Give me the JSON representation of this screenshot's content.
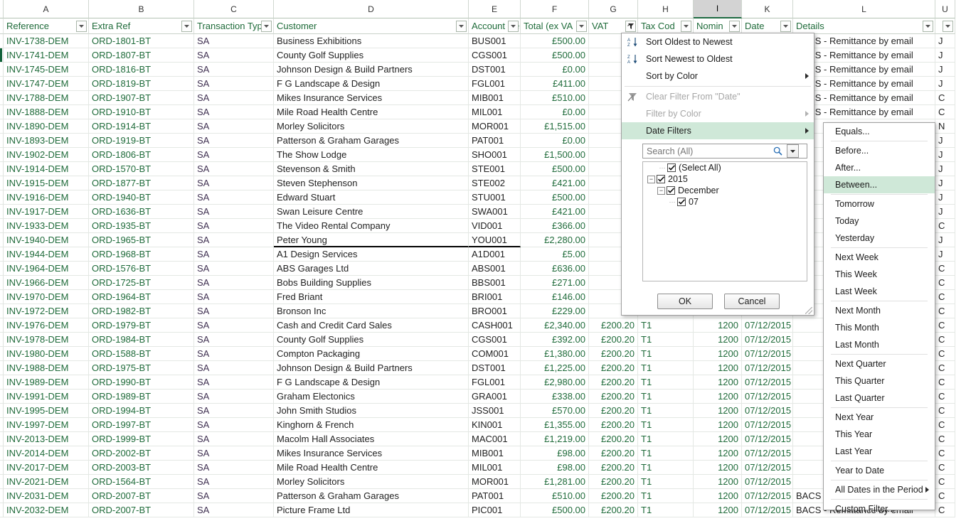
{
  "spreadsheet": {
    "column_letters": [
      "A",
      "B",
      "C",
      "D",
      "E",
      "F",
      "G",
      "H",
      "I",
      "K",
      "L",
      "U"
    ],
    "selected_column": "I",
    "headers": [
      {
        "label": "Reference",
        "filtered": false
      },
      {
        "label": "Extra Ref",
        "filtered": false
      },
      {
        "label": "Transaction Typ",
        "filtered": false
      },
      {
        "label": "Customer",
        "filtered": false
      },
      {
        "label": "Account Re",
        "filtered": false
      },
      {
        "label": "Total (ex VA",
        "filtered": false
      },
      {
        "label": "VAT",
        "filtered": true
      },
      {
        "label": "Tax Cod",
        "filtered": false
      },
      {
        "label": "Nomin",
        "filtered": false
      },
      {
        "label": "Date",
        "filtered": false
      },
      {
        "label": "Details",
        "filtered": false
      },
      {
        "label": "",
        "filtered": false
      }
    ],
    "rows": [
      {
        "reference": "INV-1738-DEM",
        "extra_ref": "ORD-1801-BT",
        "transaction_type": "SA",
        "customer": "Business Exhibitions",
        "account_ref": "BUS001",
        "total_ex_vat": "£500.00",
        "vat": "",
        "tax_code": "",
        "nominal": "",
        "date": "",
        "details": "BACS - Remittance by email",
        "last": "J"
      },
      {
        "reference": "INV-1741-DEM",
        "extra_ref": "ORD-1807-BT",
        "transaction_type": "SA",
        "customer": "County Golf Supplies",
        "account_ref": "CGS001",
        "total_ex_vat": "£500.00",
        "vat": "",
        "tax_code": "",
        "nominal": "",
        "date": "",
        "details": "BACS - Remittance by email",
        "last": "J"
      },
      {
        "reference": "INV-1745-DEM",
        "extra_ref": "ORD-1816-BT",
        "transaction_type": "SA",
        "customer": "Johnson Design & Build Partners",
        "account_ref": "DST001",
        "total_ex_vat": "£0.00",
        "vat": "",
        "tax_code": "",
        "nominal": "",
        "date": "",
        "details": "BACS - Remittance by email",
        "last": "J"
      },
      {
        "reference": "INV-1747-DEM",
        "extra_ref": "ORD-1819-BT",
        "transaction_type": "SA",
        "customer": "F G Landscape & Design",
        "account_ref": "FGL001",
        "total_ex_vat": "£411.00",
        "vat": "",
        "tax_code": "",
        "nominal": "",
        "date": "",
        "details": "BACS - Remittance by email",
        "last": "J"
      },
      {
        "reference": "INV-1788-DEM",
        "extra_ref": "ORD-1907-BT",
        "transaction_type": "SA",
        "customer": "Mikes Insurance Services",
        "account_ref": "MIB001",
        "total_ex_vat": "£510.00",
        "vat": "",
        "tax_code": "",
        "nominal": "",
        "date": "",
        "details": "BACS - Remittance by email",
        "last": "C"
      },
      {
        "reference": "INV-1888-DEM",
        "extra_ref": "ORD-1910-BT",
        "transaction_type": "SA",
        "customer": "Mile Road Health Centre",
        "account_ref": "MIL001",
        "total_ex_vat": "£0.00",
        "vat": "",
        "tax_code": "",
        "nominal": "",
        "date": "",
        "details": "BACS - Remittance by email",
        "last": "C"
      },
      {
        "reference": "INV-1890-DEM",
        "extra_ref": "ORD-1914-BT",
        "transaction_type": "SA",
        "customer": "Morley Solicitors",
        "account_ref": "MOR001",
        "total_ex_vat": "£1,515.00",
        "vat": "",
        "tax_code": "",
        "nominal": "",
        "date": "",
        "details": "",
        "last": "N"
      },
      {
        "reference": "INV-1893-DEM",
        "extra_ref": "ORD-1919-BT",
        "transaction_type": "SA",
        "customer": "Patterson & Graham Garages",
        "account_ref": "PAT001",
        "total_ex_vat": "£0.00",
        "vat": "",
        "tax_code": "",
        "nominal": "",
        "date": "",
        "details": "",
        "last": "J"
      },
      {
        "reference": "INV-1902-DEM",
        "extra_ref": "ORD-1806-BT",
        "transaction_type": "SA",
        "customer": "The Show Lodge",
        "account_ref": "SHO001",
        "total_ex_vat": "£1,500.00",
        "vat": "",
        "tax_code": "",
        "nominal": "",
        "date": "",
        "details": "",
        "last": "J"
      },
      {
        "reference": "INV-1914-DEM",
        "extra_ref": "ORD-1570-BT",
        "transaction_type": "SA",
        "customer": "Stevenson & Smith",
        "account_ref": "STE001",
        "total_ex_vat": "£500.00",
        "vat": "",
        "tax_code": "",
        "nominal": "",
        "date": "",
        "details": "",
        "last": "J"
      },
      {
        "reference": "INV-1915-DEM",
        "extra_ref": "ORD-1877-BT",
        "transaction_type": "SA",
        "customer": "Steven Stephenson",
        "account_ref": "STE002",
        "total_ex_vat": "£421.00",
        "vat": "",
        "tax_code": "",
        "nominal": "",
        "date": "",
        "details": "",
        "last": "J"
      },
      {
        "reference": "INV-1916-DEM",
        "extra_ref": "ORD-1940-BT",
        "transaction_type": "SA",
        "customer": "Edward Stuart",
        "account_ref": "STU001",
        "total_ex_vat": "£500.00",
        "vat": "",
        "tax_code": "",
        "nominal": "",
        "date": "",
        "details": "",
        "last": "J"
      },
      {
        "reference": "INV-1917-DEM",
        "extra_ref": "ORD-1636-BT",
        "transaction_type": "SA",
        "customer": "Swan Leisure Centre",
        "account_ref": "SWA001",
        "total_ex_vat": "£421.00",
        "vat": "",
        "tax_code": "",
        "nominal": "",
        "date": "",
        "details": "",
        "last": "J"
      },
      {
        "reference": "INV-1933-DEM",
        "extra_ref": "ORD-1935-BT",
        "transaction_type": "SA",
        "customer": "The Video Rental Company",
        "account_ref": "VID001",
        "total_ex_vat": "£366.00",
        "vat": "",
        "tax_code": "",
        "nominal": "",
        "date": "",
        "details": "",
        "last": "C"
      },
      {
        "reference": "INV-1940-DEM",
        "extra_ref": "ORD-1965-BT",
        "transaction_type": "SA",
        "customer": "Peter Young",
        "account_ref": "YOU001",
        "total_ex_vat": "£2,280.00",
        "vat": "",
        "tax_code": "",
        "nominal": "",
        "date": "",
        "details": "",
        "last": "J"
      },
      {
        "reference": "INV-1944-DEM",
        "extra_ref": "ORD-1968-BT",
        "transaction_type": "SA",
        "customer": "A1 Design Services",
        "account_ref": "A1D001",
        "total_ex_vat": "£5.00",
        "vat": "",
        "tax_code": "",
        "nominal": "",
        "date": "",
        "details": "",
        "last": "J"
      },
      {
        "reference": "INV-1964-DEM",
        "extra_ref": "ORD-1576-BT",
        "transaction_type": "SA",
        "customer": "ABS Garages Ltd",
        "account_ref": "ABS001",
        "total_ex_vat": "£636.00",
        "vat": "",
        "tax_code": "",
        "nominal": "",
        "date": "",
        "details": "",
        "last": "C"
      },
      {
        "reference": "INV-1966-DEM",
        "extra_ref": "ORD-1725-BT",
        "transaction_type": "SA",
        "customer": "Bobs Building Supplies",
        "account_ref": "BBS001",
        "total_ex_vat": "£271.00",
        "vat": "",
        "tax_code": "",
        "nominal": "",
        "date": "",
        "details": "",
        "last": "C"
      },
      {
        "reference": "INV-1970-DEM",
        "extra_ref": "ORD-1964-BT",
        "transaction_type": "SA",
        "customer": "Fred Briant",
        "account_ref": "BRI001",
        "total_ex_vat": "£146.00",
        "vat": "",
        "tax_code": "",
        "nominal": "",
        "date": "",
        "details": "",
        "last": "C"
      },
      {
        "reference": "INV-1972-DEM",
        "extra_ref": "ORD-1982-BT",
        "transaction_type": "SA",
        "customer": "Bronson Inc",
        "account_ref": "BRO001",
        "total_ex_vat": "£229.00",
        "vat": "",
        "tax_code": "",
        "nominal": "",
        "date": "",
        "details": "",
        "last": "C"
      },
      {
        "reference": "INV-1976-DEM",
        "extra_ref": "ORD-1979-BT",
        "transaction_type": "SA",
        "customer": "Cash and Credit Card Sales",
        "account_ref": "CASH001",
        "total_ex_vat": "£2,340.00",
        "vat": "£200.20",
        "tax_code": "T1",
        "nominal": "1200",
        "date": "07/12/2015",
        "details": "",
        "last": "C"
      },
      {
        "reference": "INV-1978-DEM",
        "extra_ref": "ORD-1984-BT",
        "transaction_type": "SA",
        "customer": "County Golf Supplies",
        "account_ref": "CGS001",
        "total_ex_vat": "£392.00",
        "vat": "£200.20",
        "tax_code": "T1",
        "nominal": "1200",
        "date": "07/12/2015",
        "details": "",
        "last": "C"
      },
      {
        "reference": "INV-1980-DEM",
        "extra_ref": "ORD-1588-BT",
        "transaction_type": "SA",
        "customer": "Compton Packaging",
        "account_ref": "COM001",
        "total_ex_vat": "£1,380.00",
        "vat": "£200.20",
        "tax_code": "T1",
        "nominal": "1200",
        "date": "07/12/2015",
        "details": "",
        "last": "C"
      },
      {
        "reference": "INV-1988-DEM",
        "extra_ref": "ORD-1975-BT",
        "transaction_type": "SA",
        "customer": "Johnson Design & Build Partners",
        "account_ref": "DST001",
        "total_ex_vat": "£1,225.00",
        "vat": "£200.20",
        "tax_code": "T1",
        "nominal": "1200",
        "date": "07/12/2015",
        "details": "",
        "last": "C"
      },
      {
        "reference": "INV-1989-DEM",
        "extra_ref": "ORD-1990-BT",
        "transaction_type": "SA",
        "customer": "F G Landscape & Design",
        "account_ref": "FGL001",
        "total_ex_vat": "£2,980.00",
        "vat": "£200.20",
        "tax_code": "T1",
        "nominal": "1200",
        "date": "07/12/2015",
        "details": "",
        "last": "C"
      },
      {
        "reference": "INV-1991-DEM",
        "extra_ref": "ORD-1989-BT",
        "transaction_type": "SA",
        "customer": "Graham Electonics",
        "account_ref": "GRA001",
        "total_ex_vat": "£338.00",
        "vat": "£200.20",
        "tax_code": "T1",
        "nominal": "1200",
        "date": "07/12/2015",
        "details": "",
        "last": "C"
      },
      {
        "reference": "INV-1995-DEM",
        "extra_ref": "ORD-1994-BT",
        "transaction_type": "SA",
        "customer": "John Smith Studios",
        "account_ref": "JSS001",
        "total_ex_vat": "£570.00",
        "vat": "£200.20",
        "tax_code": "T1",
        "nominal": "1200",
        "date": "07/12/2015",
        "details": "",
        "last": "C"
      },
      {
        "reference": "INV-1997-DEM",
        "extra_ref": "ORD-1997-BT",
        "transaction_type": "SA",
        "customer": "Kinghorn & French",
        "account_ref": "KIN001",
        "total_ex_vat": "£1,355.00",
        "vat": "£200.20",
        "tax_code": "T1",
        "nominal": "1200",
        "date": "07/12/2015",
        "details": "",
        "last": "C"
      },
      {
        "reference": "INV-2013-DEM",
        "extra_ref": "ORD-1999-BT",
        "transaction_type": "SA",
        "customer": "Macolm Hall Associates",
        "account_ref": "MAC001",
        "total_ex_vat": "£1,219.00",
        "vat": "£200.20",
        "tax_code": "T1",
        "nominal": "1200",
        "date": "07/12/2015",
        "details": "",
        "last": "C"
      },
      {
        "reference": "INV-2014-DEM",
        "extra_ref": "ORD-2002-BT",
        "transaction_type": "SA",
        "customer": "Mikes Insurance Services",
        "account_ref": "MIB001",
        "total_ex_vat": "£98.00",
        "vat": "£200.20",
        "tax_code": "T1",
        "nominal": "1200",
        "date": "07/12/2015",
        "details": "",
        "last": "C"
      },
      {
        "reference": "INV-2017-DEM",
        "extra_ref": "ORD-2003-BT",
        "transaction_type": "SA",
        "customer": "Mile Road Health Centre",
        "account_ref": "MIL001",
        "total_ex_vat": "£98.00",
        "vat": "£200.20",
        "tax_code": "T1",
        "nominal": "1200",
        "date": "07/12/2015",
        "details": "",
        "last": "C"
      },
      {
        "reference": "INV-2021-DEM",
        "extra_ref": "ORD-1564-BT",
        "transaction_type": "SA",
        "customer": "Morley Solicitors",
        "account_ref": "MOR001",
        "total_ex_vat": "£1,281.00",
        "vat": "£200.20",
        "tax_code": "T1",
        "nominal": "1200",
        "date": "07/12/2015",
        "details": "",
        "last": "C"
      },
      {
        "reference": "INV-2031-DEM",
        "extra_ref": "ORD-2007-BT",
        "transaction_type": "SA",
        "customer": "Patterson & Graham Garages",
        "account_ref": "PAT001",
        "total_ex_vat": "£510.00",
        "vat": "£200.20",
        "tax_code": "T1",
        "nominal": "1200",
        "date": "07/12/2015",
        "details": "BACS - Remittance by email",
        "last": "C"
      },
      {
        "reference": "INV-2032-DEM",
        "extra_ref": "ORD-2007-BT",
        "transaction_type": "SA",
        "customer": "Picture Frame Ltd",
        "account_ref": "PIC001",
        "total_ex_vat": "£500.00",
        "vat": "£200.20",
        "tax_code": "T1",
        "nominal": "1200",
        "date": "07/12/2015",
        "details": "BACS - Remittance by email",
        "last": "C"
      }
    ],
    "thick_border_after_row_index": 14,
    "active_cell_row_index": 1
  },
  "filter_menu": {
    "items": [
      {
        "label": "Sort Oldest to Newest",
        "icon": "sort-az-icon",
        "disabled": false,
        "submenu": false,
        "highlighted": false
      },
      {
        "label": "Sort Newest to Oldest",
        "icon": "sort-za-icon",
        "disabled": false,
        "submenu": false,
        "highlighted": false
      },
      {
        "label": "Sort by Color",
        "icon": "none",
        "disabled": false,
        "submenu": true,
        "highlighted": false
      },
      {
        "label": "Clear Filter From \"Date\"",
        "icon": "clear-filter-icon",
        "disabled": true,
        "submenu": false,
        "highlighted": false
      },
      {
        "label": "Filter by Color",
        "icon": "none",
        "disabled": true,
        "submenu": true,
        "highlighted": false
      },
      {
        "label": "Date Filters",
        "icon": "none",
        "disabled": false,
        "submenu": true,
        "highlighted": true
      }
    ],
    "search": {
      "placeholder": "Search (All)",
      "value": ""
    },
    "tree": [
      {
        "label": "(Select All)",
        "indent": 1,
        "checked": true,
        "expander": "none"
      },
      {
        "label": "2015",
        "indent": 0,
        "checked": true,
        "expander": "minus"
      },
      {
        "label": "December",
        "indent": 1,
        "checked": true,
        "expander": "minus"
      },
      {
        "label": "07",
        "indent": 2,
        "checked": true,
        "expander": "none"
      }
    ],
    "ok_label": "OK",
    "cancel_label": "Cancel"
  },
  "date_filters_submenu": {
    "items": [
      {
        "label": "Equals...",
        "submenu": false,
        "highlighted": false,
        "sep_after": true
      },
      {
        "label": "Before...",
        "submenu": false,
        "highlighted": false,
        "sep_after": false
      },
      {
        "label": "After...",
        "submenu": false,
        "highlighted": false,
        "sep_after": false
      },
      {
        "label": "Between...",
        "submenu": false,
        "highlighted": true,
        "sep_after": true
      },
      {
        "label": "Tomorrow",
        "submenu": false,
        "highlighted": false,
        "sep_after": false
      },
      {
        "label": "Today",
        "submenu": false,
        "highlighted": false,
        "sep_after": false
      },
      {
        "label": "Yesterday",
        "submenu": false,
        "highlighted": false,
        "sep_after": true
      },
      {
        "label": "Next Week",
        "submenu": false,
        "highlighted": false,
        "sep_after": false
      },
      {
        "label": "This Week",
        "submenu": false,
        "highlighted": false,
        "sep_after": false
      },
      {
        "label": "Last Week",
        "submenu": false,
        "highlighted": false,
        "sep_after": true
      },
      {
        "label": "Next Month",
        "submenu": false,
        "highlighted": false,
        "sep_after": false
      },
      {
        "label": "This Month",
        "submenu": false,
        "highlighted": false,
        "sep_after": false
      },
      {
        "label": "Last Month",
        "submenu": false,
        "highlighted": false,
        "sep_after": true
      },
      {
        "label": "Next Quarter",
        "submenu": false,
        "highlighted": false,
        "sep_after": false
      },
      {
        "label": "This Quarter",
        "submenu": false,
        "highlighted": false,
        "sep_after": false
      },
      {
        "label": "Last Quarter",
        "submenu": false,
        "highlighted": false,
        "sep_after": true
      },
      {
        "label": "Next Year",
        "submenu": false,
        "highlighted": false,
        "sep_after": false
      },
      {
        "label": "This Year",
        "submenu": false,
        "highlighted": false,
        "sep_after": false
      },
      {
        "label": "Last Year",
        "submenu": false,
        "highlighted": false,
        "sep_after": true
      },
      {
        "label": "Year to Date",
        "submenu": false,
        "highlighted": false,
        "sep_after": true
      },
      {
        "label": "All Dates in the Period",
        "submenu": true,
        "highlighted": false,
        "sep_after": true
      },
      {
        "label": "Custom Filter...",
        "submenu": false,
        "highlighted": false,
        "sep_after": false
      }
    ]
  },
  "colors": {
    "header_text": "#1f6b3a",
    "data_text": "#1f6b3a",
    "customer_text": "#222222",
    "transaction_text": "#403152",
    "menu_highlight": "#cfe8d8",
    "selected_column": "#d3d3d3"
  }
}
